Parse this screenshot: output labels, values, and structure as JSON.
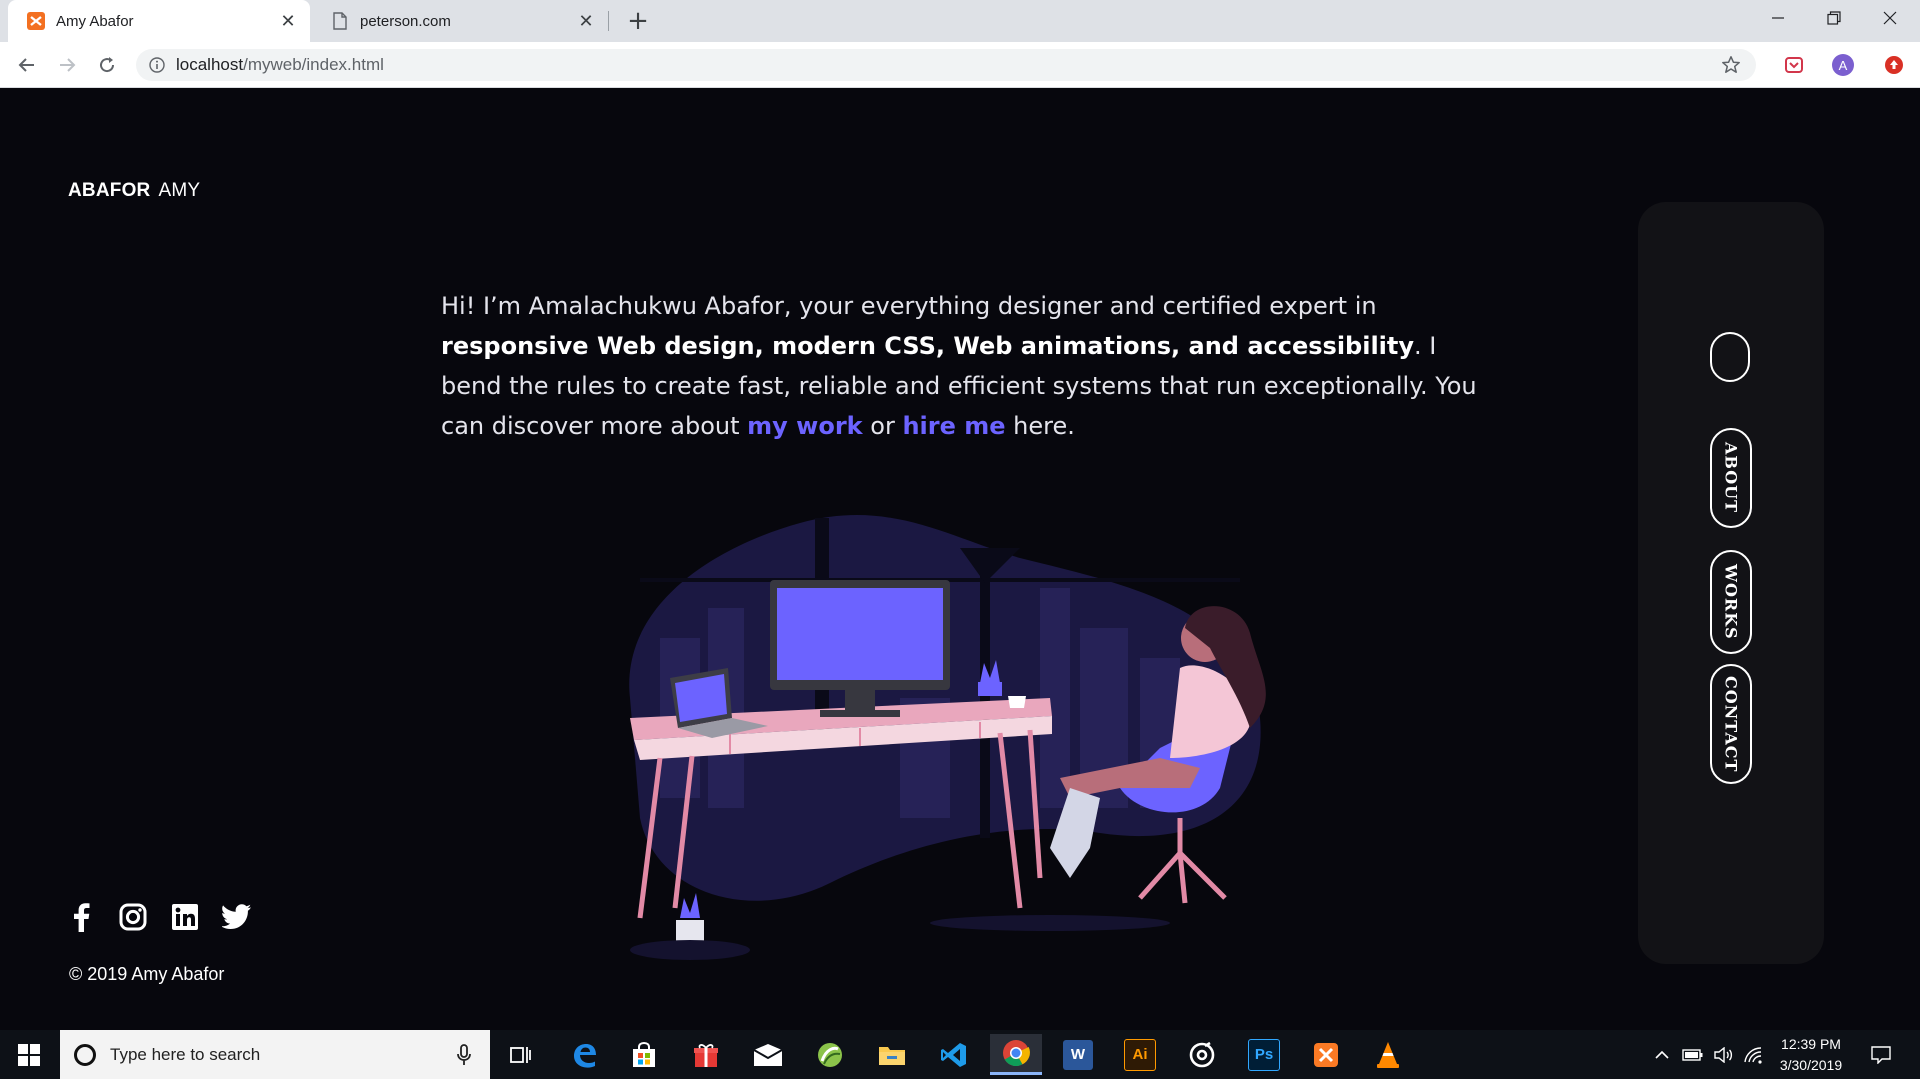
{
  "browser": {
    "tabs": [
      {
        "title": "Amy Abafor",
        "active": true
      },
      {
        "title": "peterson.com",
        "active": false
      }
    ],
    "url_host": "localhost",
    "url_path": "/myweb/index.html",
    "profile_initial": "A"
  },
  "page": {
    "brand": {
      "first": "ABAFOR",
      "second": "AMY"
    },
    "intro": {
      "part1": "Hi! I’m Amalachukwu Abafor, your everything designer and certified expert in ",
      "strong": "responsive Web design, modern CSS, Web animations, and accessibility",
      "part2": ". I bend the rules to create fast, reliable and efficient systems that run exceptionally. You can discover more about ",
      "link_work": "my work",
      "part3": " or ",
      "link_hire": "hire me",
      "part4": " here."
    },
    "nav": {
      "about": "ABOUT",
      "works": "WORKS",
      "contact": "CONTACT"
    },
    "social_icons": [
      "facebook-icon",
      "instagram-icon",
      "linkedin-icon",
      "twitter-icon"
    ],
    "copyright": "© 2019 Amy Abafor",
    "accent_color": "#6c63ff"
  },
  "taskbar": {
    "search_placeholder": "Type here to search",
    "apps": [
      "task-view-icon",
      "edge-icon",
      "store-icon",
      "gift-icon",
      "mail-icon",
      "app-green-icon",
      "file-explorer-icon",
      "vscode-icon",
      "chrome-icon",
      "word-icon",
      "illustrator-icon",
      "media-icon",
      "photoshop-icon",
      "xampp-icon",
      "vlc-icon"
    ],
    "illustrator_label": "Ai",
    "photoshop_label": "Ps",
    "word_label": "W",
    "time": "12:39 PM",
    "date": "3/30/2019"
  }
}
